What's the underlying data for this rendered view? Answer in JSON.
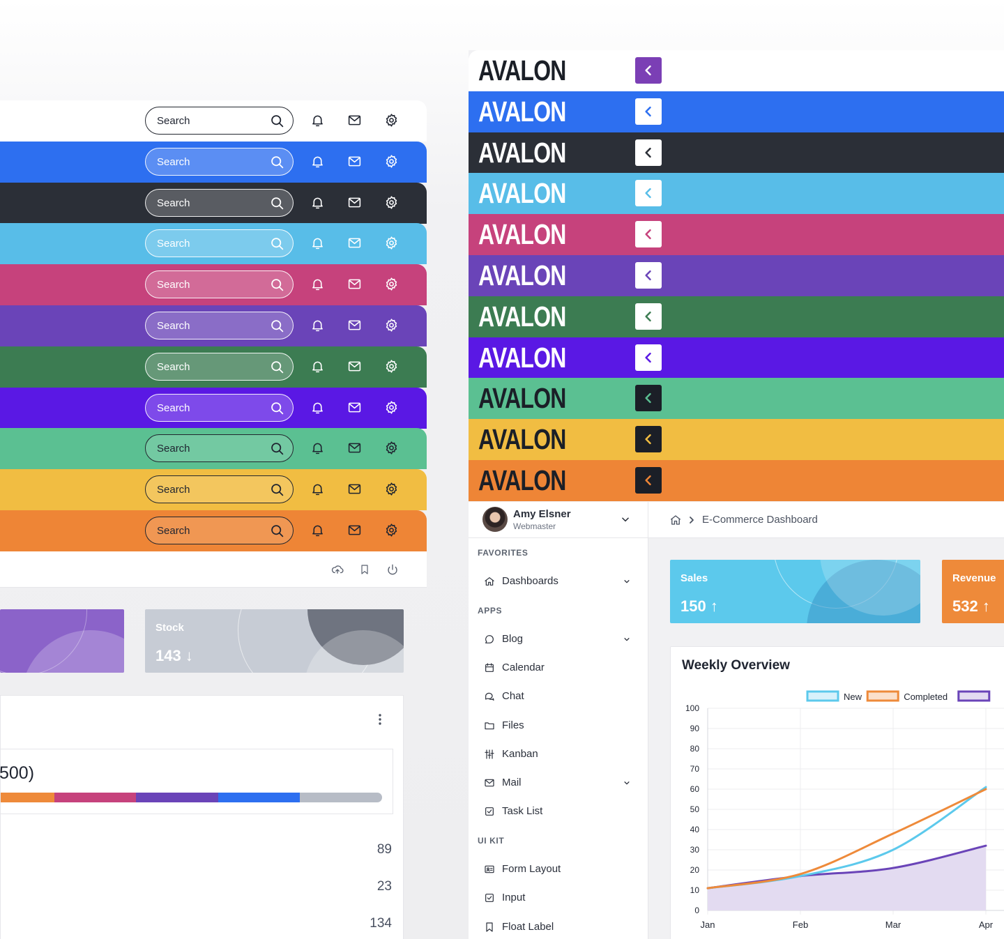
{
  "left": {
    "search_placeholder": "Search",
    "topbars": [
      {
        "bg": "#ffffff",
        "scheme": "white"
      },
      {
        "bg": "#2d6ff0",
        "scheme": "light"
      },
      {
        "bg": "#2b2f37",
        "scheme": "light"
      },
      {
        "bg": "#58bde8",
        "scheme": "light"
      },
      {
        "bg": "#c6427c",
        "scheme": "light"
      },
      {
        "bg": "#6a44b8",
        "scheme": "light"
      },
      {
        "bg": "#3c7c52",
        "scheme": "light"
      },
      {
        "bg": "#5a18e4",
        "scheme": "light"
      },
      {
        "bg": "#5bc092",
        "scheme": "dark"
      },
      {
        "bg": "#f1bd42",
        "scheme": "dark"
      },
      {
        "bg": "#ee8536",
        "scheme": "dark"
      }
    ],
    "stock_card": {
      "label": "Stock",
      "value": "143 ↓"
    },
    "progress_total": "500)",
    "progress_segments": [
      {
        "color": "#ee8a3a",
        "percent": 14
      },
      {
        "color": "#c6427c",
        "percent": 21.5
      },
      {
        "color": "#6a44b8",
        "percent": 21.5
      },
      {
        "color": "#2d6ff0",
        "percent": 21.5
      },
      {
        "color": "#b7bcc6",
        "percent": 21.5
      }
    ],
    "row_values": [
      "89",
      "23",
      "134"
    ]
  },
  "right": {
    "brand": "AVALON",
    "brand_bars": [
      {
        "bg": "#ffffff",
        "logo": "dark",
        "btn_bg": "#7b3fb5",
        "btn_icon": "#ffffff"
      },
      {
        "bg": "#2d6ff0",
        "logo": "light",
        "btn_bg": "#ffffff",
        "btn_icon": "#2d6ff0"
      },
      {
        "bg": "#2b2f37",
        "logo": "light",
        "btn_bg": "#ffffff",
        "btn_icon": "#2b2f37"
      },
      {
        "bg": "#58bde8",
        "logo": "light",
        "btn_bg": "#ffffff",
        "btn_icon": "#58bde8"
      },
      {
        "bg": "#c6427c",
        "logo": "light",
        "btn_bg": "#ffffff",
        "btn_icon": "#c6427c"
      },
      {
        "bg": "#6a44b8",
        "logo": "light",
        "btn_bg": "#ffffff",
        "btn_icon": "#6a44b8"
      },
      {
        "bg": "#3c7c52",
        "logo": "light",
        "btn_bg": "#ffffff",
        "btn_icon": "#3c7c52"
      },
      {
        "bg": "#5a18e4",
        "logo": "light",
        "btn_bg": "#ffffff",
        "btn_icon": "#5a18e4"
      },
      {
        "bg": "#5bc092",
        "logo": "dark",
        "btn_bg": "#1b1f27",
        "btn_icon": "#5bc092"
      },
      {
        "bg": "#f1bd42",
        "logo": "dark",
        "btn_bg": "#1b1f27",
        "btn_icon": "#f1bd42"
      },
      {
        "bg": "#ee8536",
        "logo": "dark",
        "btn_bg": "#1b1f27",
        "btn_icon": "#ee8536"
      }
    ],
    "user": {
      "name": "Amy Elsner",
      "role": "Webmaster"
    },
    "breadcrumb": {
      "current": "E-Commerce Dashboard"
    },
    "nav": [
      {
        "type": "section",
        "label": "FAVORITES"
      },
      {
        "type": "item",
        "label": "Dashboards",
        "icon": "home-icon",
        "chevron": true
      },
      {
        "type": "section",
        "label": "APPS"
      },
      {
        "type": "item",
        "label": "Blog",
        "icon": "comment-icon",
        "chevron": true
      },
      {
        "type": "item",
        "label": "Calendar",
        "icon": "calendar-icon",
        "chevron": false
      },
      {
        "type": "item",
        "label": "Chat",
        "icon": "chat-icon",
        "chevron": false
      },
      {
        "type": "item",
        "label": "Files",
        "icon": "folder-icon",
        "chevron": false
      },
      {
        "type": "item",
        "label": "Kanban",
        "icon": "kanban-icon",
        "chevron": false
      },
      {
        "type": "item",
        "label": "Mail",
        "icon": "mail-icon",
        "chevron": true
      },
      {
        "type": "item",
        "label": "Task List",
        "icon": "check-square-icon",
        "chevron": false
      },
      {
        "type": "section",
        "label": "UI KIT"
      },
      {
        "type": "item",
        "label": "Form Layout",
        "icon": "id-card-icon",
        "chevron": false
      },
      {
        "type": "item",
        "label": "Input",
        "icon": "check-square-icon",
        "chevron": false
      },
      {
        "type": "item",
        "label": "Float Label",
        "icon": "bookmark-icon",
        "chevron": false
      }
    ],
    "sales_card": {
      "label": "Sales",
      "value": "150 ↑"
    },
    "revenue_card": {
      "label": "Revenue",
      "value": "532 ↑"
    }
  },
  "chart_data": {
    "type": "line",
    "title": "Weekly Overview",
    "categories": [
      "Jan",
      "Feb",
      "Mar",
      "Apr"
    ],
    "ylim": [
      0,
      100
    ],
    "yticks": [
      0,
      10,
      20,
      30,
      40,
      50,
      60,
      70,
      80,
      90,
      100
    ],
    "grid": true,
    "legend_position": "top-right",
    "series": [
      {
        "name": "New",
        "color": "#5cc9ec",
        "fill": "#d7f1fb",
        "values": [
          11,
          17,
          30,
          61
        ]
      },
      {
        "name": "Completed",
        "color": "#ee8a3a",
        "fill": "#fbe0cb",
        "values": [
          11,
          18,
          38,
          60
        ]
      },
      {
        "name": "",
        "color": "#6a44b8",
        "fill": "#e3dbf1",
        "area": true,
        "values": [
          11,
          17,
          21,
          32
        ]
      }
    ]
  }
}
